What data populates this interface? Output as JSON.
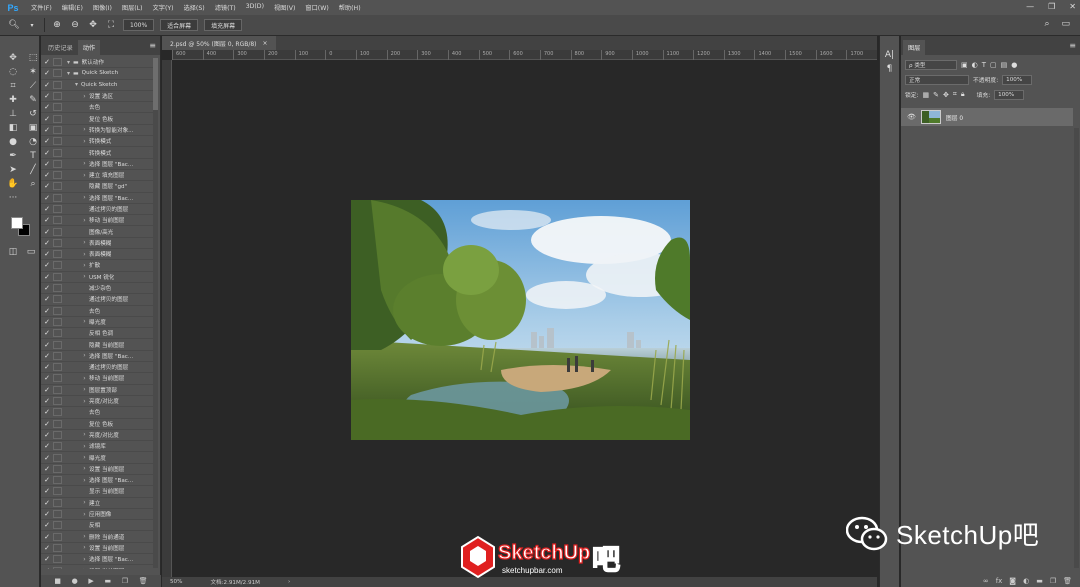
{
  "app": {
    "logo": "Ps",
    "menus": [
      "文件(F)",
      "编辑(E)",
      "图像(I)",
      "图层(L)",
      "文字(Y)",
      "选择(S)",
      "滤镜(T)",
      "3D(D)",
      "视图(V)",
      "窗口(W)",
      "帮助(H)"
    ],
    "window_controls": [
      "—",
      "❐",
      "✕"
    ]
  },
  "options": {
    "zoom_value": "100%",
    "fit_screen": "适合屏幕",
    "fill_screen": "填充屏幕"
  },
  "left_panel": {
    "tabs": [
      "历史记录",
      "动作"
    ],
    "actions": [
      {
        "check": "✓",
        "arrow": "▾",
        "label": "默认动作",
        "indent": 0,
        "folder": true
      },
      {
        "check": "✓",
        "arrow": "▾",
        "label": "Quick Sketch",
        "indent": 0,
        "folder": true
      },
      {
        "check": "✓",
        "arrow": "▾",
        "label": "Quick Sketch",
        "indent": 1
      },
      {
        "check": "✓",
        "arrow": "›",
        "label": "设置 选区",
        "indent": 2
      },
      {
        "check": "✓",
        "arrow": "",
        "label": "去色",
        "indent": 2
      },
      {
        "check": "✓",
        "arrow": "",
        "label": "复位 色板",
        "indent": 2
      },
      {
        "check": "✓",
        "arrow": "›",
        "label": "转换为智能对象...",
        "indent": 2
      },
      {
        "check": "✓",
        "arrow": "›",
        "label": "转换模式",
        "indent": 2
      },
      {
        "check": "✓",
        "arrow": "",
        "label": "转换模式",
        "indent": 2
      },
      {
        "check": "✓",
        "arrow": "›",
        "label": "选择 图层 \"Bac...",
        "indent": 2
      },
      {
        "check": "✓",
        "arrow": "›",
        "label": "建立 填充图层",
        "indent": 2
      },
      {
        "check": "✓",
        "arrow": "",
        "label": "隐藏 图层 \"gd\"",
        "indent": 2
      },
      {
        "check": "✓",
        "arrow": "›",
        "label": "选择 图层 \"Bac...",
        "indent": 2
      },
      {
        "check": "✓",
        "arrow": "",
        "label": "通过拷贝的图层",
        "indent": 2
      },
      {
        "check": "✓",
        "arrow": "›",
        "label": "移动 当前图层",
        "indent": 2
      },
      {
        "check": "✓",
        "arrow": "",
        "label": "图像/高光",
        "indent": 2
      },
      {
        "check": "✓",
        "arrow": "›",
        "label": "表面模糊",
        "indent": 2
      },
      {
        "check": "✓",
        "arrow": "›",
        "label": "表面模糊",
        "indent": 2
      },
      {
        "check": "✓",
        "arrow": "›",
        "label": "扩散",
        "indent": 2
      },
      {
        "check": "✓",
        "arrow": "›",
        "label": "USM 锐化",
        "indent": 2
      },
      {
        "check": "✓",
        "arrow": "",
        "label": "减少杂色",
        "indent": 2
      },
      {
        "check": "✓",
        "arrow": "",
        "label": "通过拷贝的图层",
        "indent": 2
      },
      {
        "check": "✓",
        "arrow": "",
        "label": "去色",
        "indent": 2
      },
      {
        "check": "✓",
        "arrow": "›",
        "label": "曝光度",
        "indent": 2
      },
      {
        "check": "✓",
        "arrow": "",
        "label": "反相 色调",
        "indent": 2
      },
      {
        "check": "✓",
        "arrow": "",
        "label": "隐藏 当前图层",
        "indent": 2
      },
      {
        "check": "✓",
        "arrow": "›",
        "label": "选择 图层 \"Bac...",
        "indent": 2
      },
      {
        "check": "✓",
        "arrow": "",
        "label": "通过拷贝的图层",
        "indent": 2
      },
      {
        "check": "✓",
        "arrow": "›",
        "label": "移动 当前图层",
        "indent": 2
      },
      {
        "check": "✓",
        "arrow": "›",
        "label": "图层置顶部",
        "indent": 2
      },
      {
        "check": "✓",
        "arrow": "›",
        "label": "亮度/对比度",
        "indent": 2
      },
      {
        "check": "✓",
        "arrow": "",
        "label": "去色",
        "indent": 2
      },
      {
        "check": "✓",
        "arrow": "",
        "label": "复位 色板",
        "indent": 2
      },
      {
        "check": "✓",
        "arrow": "›",
        "label": "亮度/对比度",
        "indent": 2
      },
      {
        "check": "✓",
        "arrow": "›",
        "label": "滤镜库",
        "indent": 2
      },
      {
        "check": "✓",
        "arrow": "›",
        "label": "曝光度",
        "indent": 2
      },
      {
        "check": "✓",
        "arrow": "›",
        "label": "设置 当前图层",
        "indent": 2
      },
      {
        "check": "✓",
        "arrow": "›",
        "label": "选择 图层 \"Bac...",
        "indent": 2
      },
      {
        "check": "✓",
        "arrow": "",
        "label": "显示 当前图层",
        "indent": 2
      },
      {
        "check": "✓",
        "arrow": "›",
        "label": "建立",
        "indent": 2
      },
      {
        "check": "✓",
        "arrow": "›",
        "label": "应用图像",
        "indent": 2
      },
      {
        "check": "✓",
        "arrow": "",
        "label": "反相",
        "indent": 2
      },
      {
        "check": "✓",
        "arrow": "›",
        "label": "删除 当前通道",
        "indent": 2
      },
      {
        "check": "✓",
        "arrow": "›",
        "label": "设置 当前图层",
        "indent": 2
      },
      {
        "check": "✓",
        "arrow": "›",
        "label": "选择 图层 \"Bac...",
        "indent": 2
      },
      {
        "check": "✓",
        "arrow": "›",
        "label": "设置 当前图层",
        "indent": 2
      }
    ]
  },
  "document": {
    "tab_title": "2.psd @ 50% (图层 0, RGB/8)",
    "tab_close": "×",
    "ruler_ticks": [
      "600",
      "400",
      "300",
      "200",
      "100",
      "0",
      "100",
      "200",
      "300",
      "400",
      "500",
      "600",
      "700",
      "800",
      "900",
      "1000",
      "1100",
      "1200",
      "1300",
      "1400",
      "1500",
      "1600",
      "1700"
    ],
    "status_zoom": "50%",
    "status_doc": "文档:2.91M/2.91M",
    "status_arrow": "›"
  },
  "layers_panel": {
    "tab": "图层",
    "kind_filter": "ρ 类型",
    "blend_mode": "正常",
    "opacity_label": "不透明度:",
    "opacity_value": "100%",
    "lock_label": "锁定:",
    "fill_label": "填充:",
    "fill_value": "100%",
    "layer_name": "图层 0"
  },
  "watermarks": {
    "logo_text": "SketchUp",
    "logo_url": "sketchupbar.com",
    "logo_char": "吧",
    "wechat_text": "SketchUp吧"
  }
}
